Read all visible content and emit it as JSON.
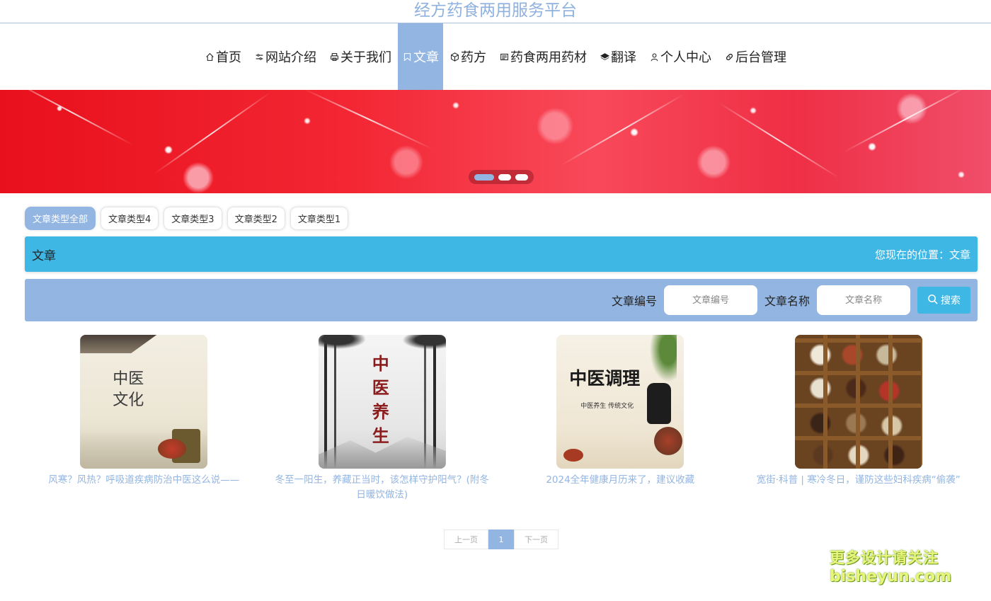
{
  "site": {
    "title": "经方药食两用服务平台"
  },
  "nav": {
    "items": [
      {
        "label": "首页",
        "icon": "home-icon"
      },
      {
        "label": "网站介绍",
        "icon": "sliders-icon"
      },
      {
        "label": "关于我们",
        "icon": "printer-icon"
      },
      {
        "label": "文章",
        "icon": "bookmark-icon",
        "active": true
      },
      {
        "label": "药方",
        "icon": "cube-icon"
      },
      {
        "label": "药食两用药材",
        "icon": "newspaper-icon"
      },
      {
        "label": "翻译",
        "icon": "layers-icon"
      },
      {
        "label": "个人中心",
        "icon": "user-icon"
      },
      {
        "label": "后台管理",
        "icon": "link-icon"
      }
    ]
  },
  "banner": {
    "slides": 3,
    "active_slide": 1
  },
  "types": [
    "文章类型全部",
    "文章类型4",
    "文章类型3",
    "文章类型2",
    "文章类型1"
  ],
  "header": {
    "title": "文章",
    "breadcrumb": "您现在的位置：文章"
  },
  "search": {
    "field1_label": "文章编号",
    "field1_placeholder": "文章编号",
    "field2_label": "文章名称",
    "field2_placeholder": "文章名称",
    "button_label": "搜索"
  },
  "articles": [
    {
      "title": "风寒？风热？呼吸道疾病防治中医这么说——",
      "image_text": "中医文化"
    },
    {
      "title": "冬至一阳生，养藏正当时，该怎样守护阳气？(附冬日暖饮做法)",
      "image_text": "中医养生"
    },
    {
      "title": "2024全年健康月历来了，建议收藏",
      "image_text": "中医调理",
      "image_subtext": "中医养生 传统文化"
    },
    {
      "title": "宽街·科普 | 寒冷冬日，谨防这些妇科疾病“偷袭”",
      "image_text": ""
    }
  ],
  "pagination": {
    "prev": "上一页",
    "current": "1",
    "next": "下一页"
  },
  "watermark": {
    "line1": "更多设计请关注",
    "line2": "bisheyun.com"
  },
  "colors": {
    "primary": "#93b5e1",
    "accent": "#3fb7e4",
    "banner": "#f32633"
  }
}
